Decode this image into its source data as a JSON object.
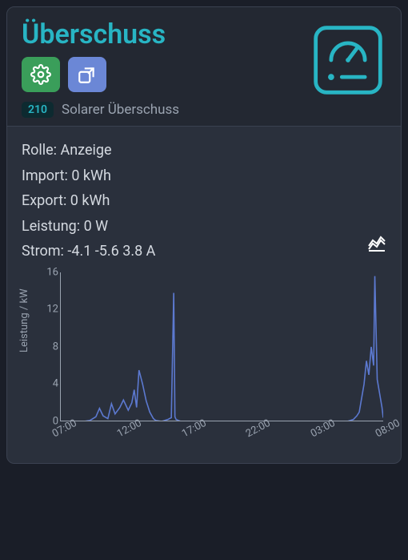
{
  "header": {
    "title": "Überschuss",
    "badge": "210",
    "subtitle": "Solarer Überschuss"
  },
  "readings": {
    "role_label": "Rolle:",
    "role_value": "Anzeige",
    "import_label": "Import:",
    "import_value": "0 kWh",
    "export_label": "Export:",
    "export_value": "0 kWh",
    "power_label": "Leistung:",
    "power_value": "0 W",
    "current_label": "Strom:",
    "current_value": "-4.1 -5.6 3.8 A"
  },
  "chart_data": {
    "type": "line",
    "ylabel": "Leistung / kW",
    "ylim": [
      0,
      16
    ],
    "y_ticks": [
      0,
      4,
      8,
      12,
      16
    ],
    "x_ticks": [
      "07:00",
      "12:00",
      "17:00",
      "22:00",
      "03:00",
      "08:00"
    ],
    "x": [
      7.0,
      8.0,
      9.0,
      9.5,
      10.0,
      10.3,
      10.6,
      11.0,
      11.3,
      11.6,
      12.0,
      12.3,
      12.7,
      13.0,
      13.2,
      13.4,
      13.6,
      13.9,
      14.2,
      14.5,
      14.8,
      15.0,
      15.5,
      16.0,
      16.3,
      16.5,
      16.6,
      16.7,
      16.9,
      17.1,
      17.4,
      18.0,
      20.0,
      22.0,
      24.0,
      26.0,
      28.0,
      30.0,
      31.0,
      31.5,
      31.8,
      32.0,
      32.2,
      32.4,
      32.6,
      32.8,
      33.0,
      33.2,
      33.3,
      33.5,
      33.7,
      33.9,
      34.0
    ],
    "values": [
      0.0,
      0.0,
      0.0,
      0.1,
      0.5,
      1.4,
      0.6,
      0.3,
      1.9,
      0.8,
      1.5,
      2.3,
      1.2,
      2.0,
      3.4,
      1.5,
      5.5,
      4.0,
      2.2,
      1.0,
      0.3,
      0.1,
      0.0,
      0.2,
      0.4,
      13.8,
      0.5,
      0.2,
      0.1,
      0.0,
      0.0,
      0.0,
      0.0,
      0.0,
      0.0,
      0.0,
      0.0,
      0.0,
      0.0,
      0.2,
      0.6,
      1.0,
      2.5,
      4.0,
      6.5,
      5.0,
      8.0,
      6.0,
      15.6,
      4.5,
      3.0,
      1.5,
      0.4
    ]
  }
}
